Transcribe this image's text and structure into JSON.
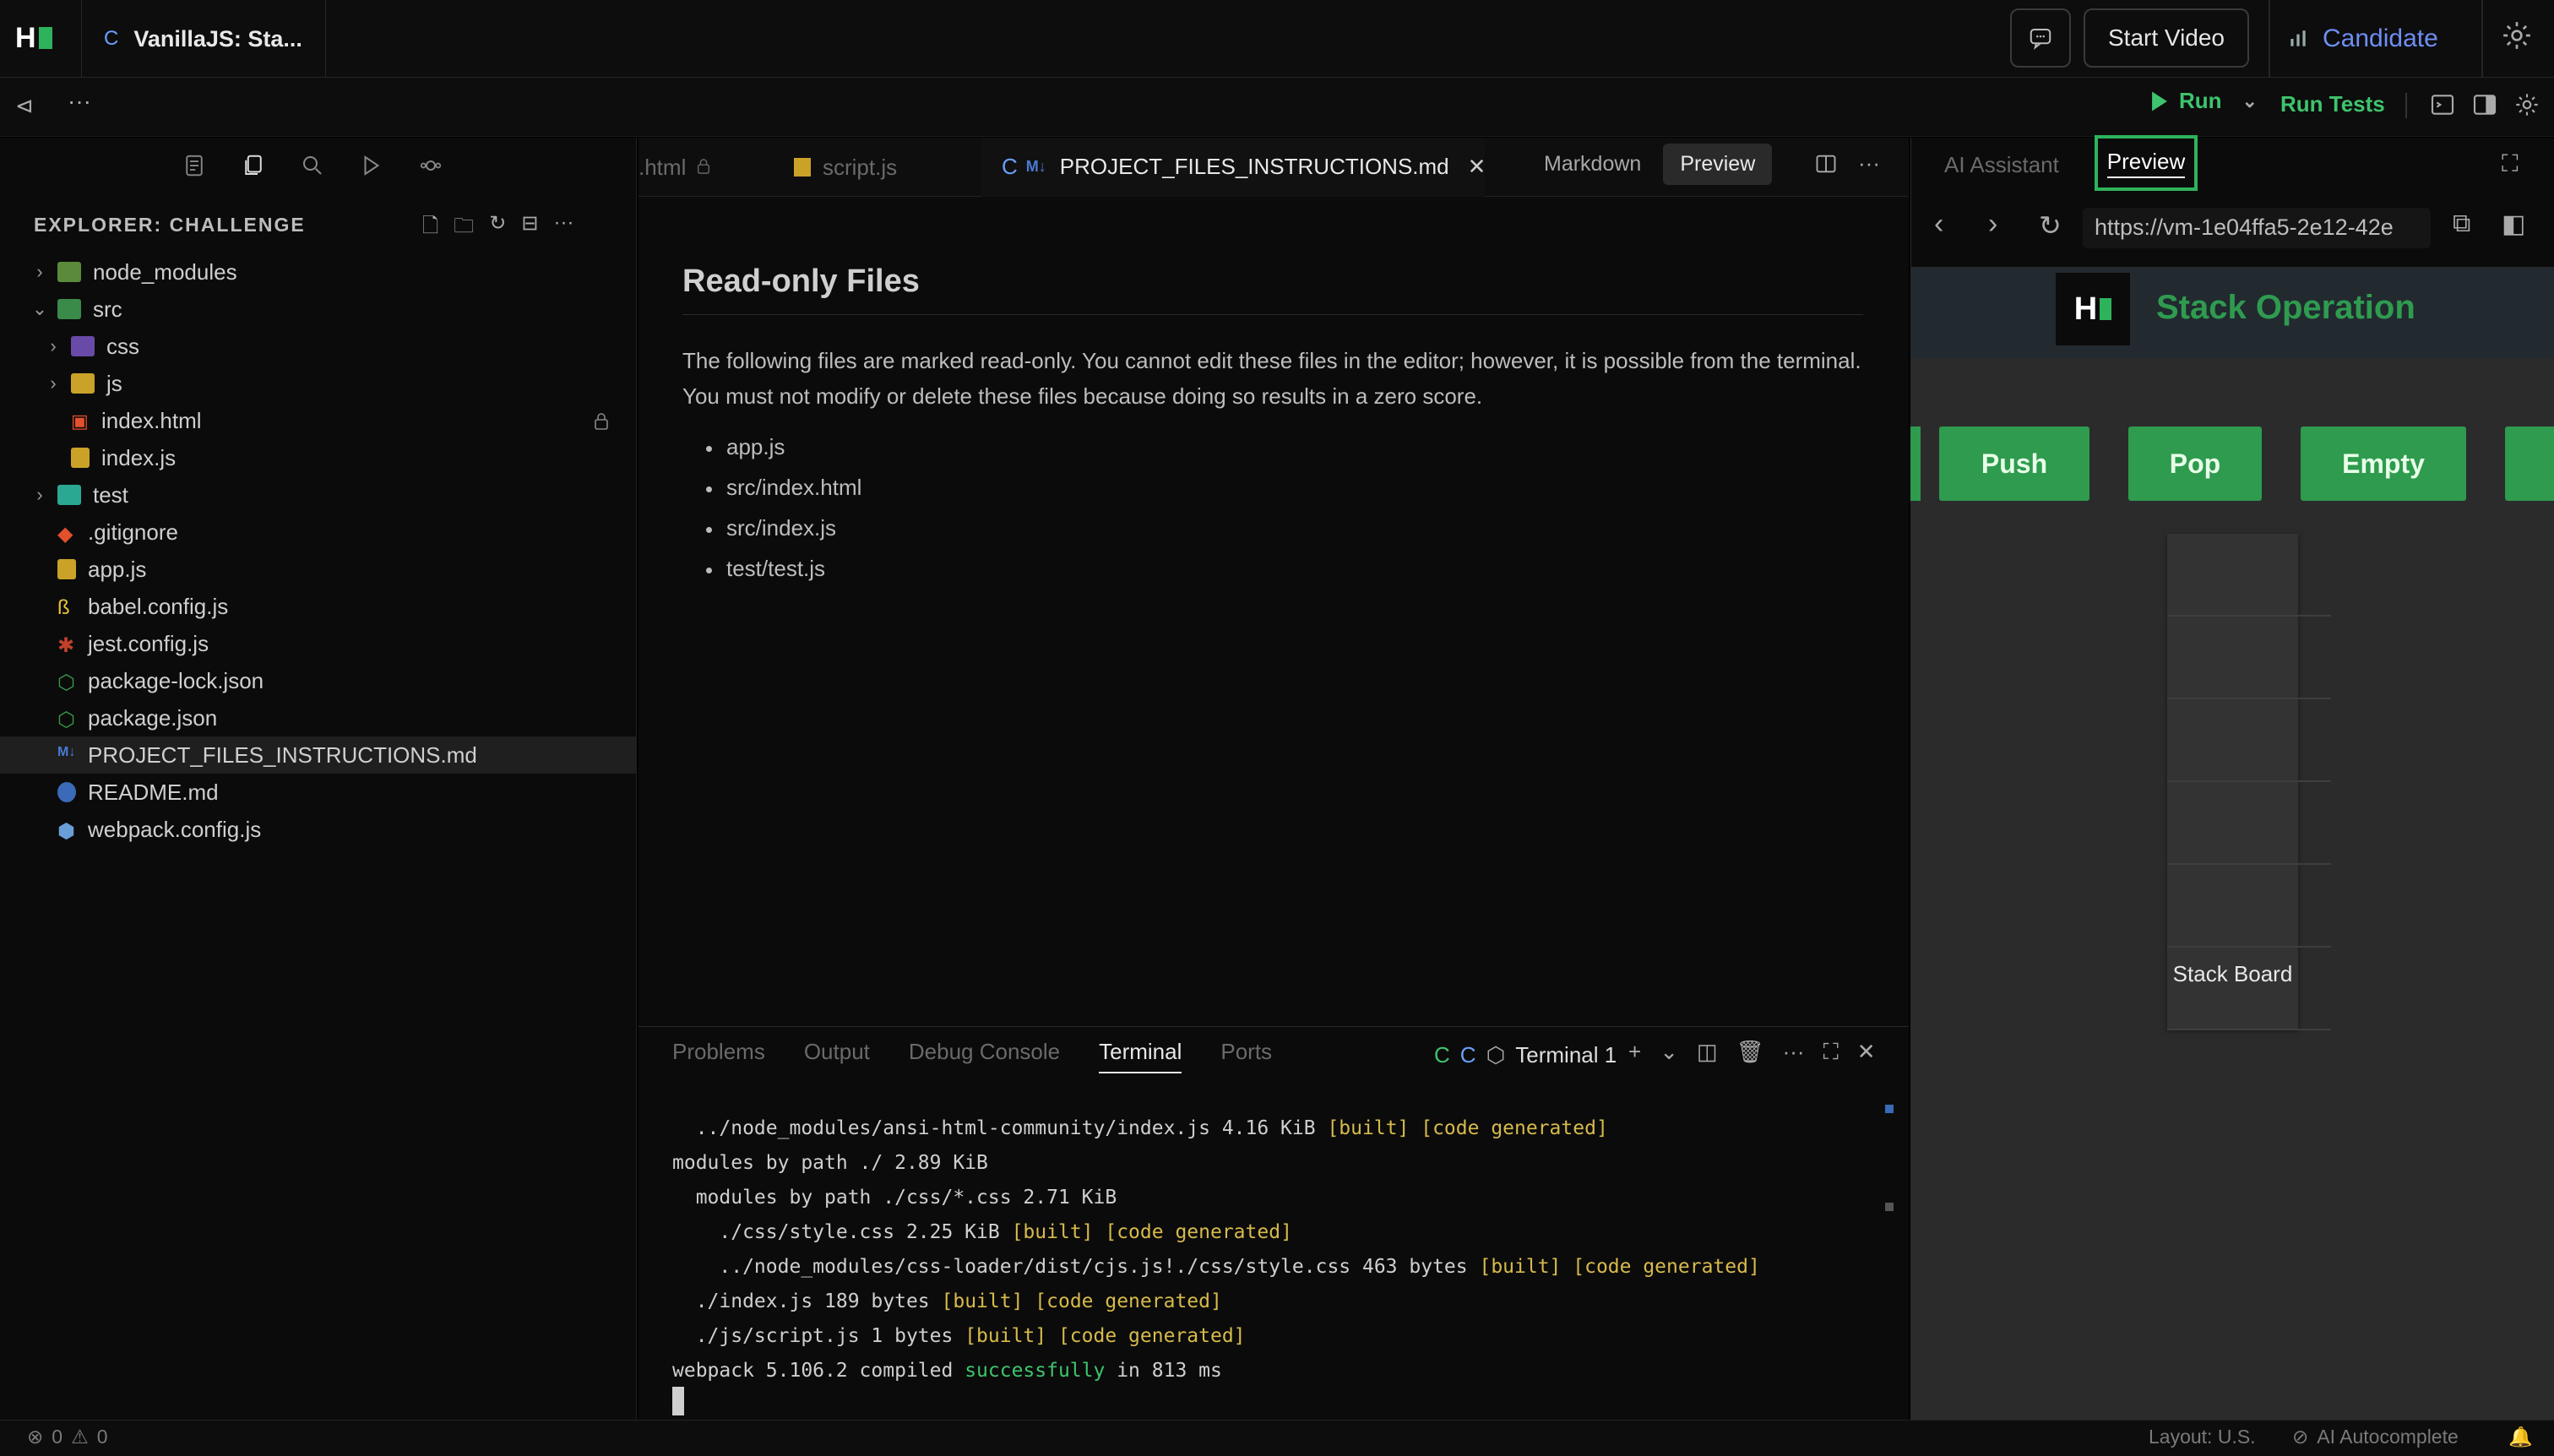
{
  "topbar": {
    "tab_icon": "C",
    "tab_title": "VanillaJS: Sta...",
    "start_video": "Start Video",
    "candidate": "Candidate"
  },
  "toolbar": {
    "run": "Run",
    "run_tests": "Run Tests"
  },
  "explorer": {
    "title": "EXPLORER: CHALLENGE",
    "items": [
      {
        "label": "node_modules"
      },
      {
        "label": "src"
      },
      {
        "label": "css"
      },
      {
        "label": "js"
      },
      {
        "label": "index.html"
      },
      {
        "label": "index.js"
      },
      {
        "label": "test"
      },
      {
        "label": ".gitignore"
      },
      {
        "label": "app.js"
      },
      {
        "label": "babel.config.js"
      },
      {
        "label": "jest.config.js"
      },
      {
        "label": "package-lock.json"
      },
      {
        "label": "package.json"
      },
      {
        "label": "PROJECT_FILES_INSTRUCTIONS.md"
      },
      {
        "label": "README.md"
      },
      {
        "label": "webpack.config.js"
      }
    ]
  },
  "editor": {
    "tabs": [
      {
        "label": ".html"
      },
      {
        "label": "script.js"
      },
      {
        "label": "PROJECT_FILES_INSTRUCTIONS.md"
      }
    ],
    "active_icon": "C",
    "md_badge": "M↓",
    "markdown_btn": "Markdown",
    "preview_btn": "Preview",
    "heading": "Read-only Files",
    "paragraph": "The following files are marked read-only. You cannot edit these files in the editor; however, it is possible from the terminal. You must not modify or delete these files because doing so results in a zero score.",
    "list": [
      "app.js",
      "src/index.html",
      "src/index.js",
      "test/test.js"
    ]
  },
  "panel": {
    "tabs": [
      "Problems",
      "Output",
      "Debug Console",
      "Terminal",
      "Ports"
    ],
    "terminal_name": "Terminal 1",
    "lines": {
      "l1a": "  ../node_modules/ansi-html-community/index.js 4.16 KiB ",
      "l1b": "[built] [code generated]",
      "l2": "modules by path ./ 2.89 KiB",
      "l3": "  modules by path ./css/*.css 2.71 KiB",
      "l4a": "    ./css/style.css 2.25 KiB ",
      "l4b": "[built] [code generated]",
      "l5a": "    ../node_modules/css-loader/dist/cjs.js!./css/style.css 463 bytes ",
      "l5b": "[built] [code generated]",
      "l6a": "  ./index.js 189 bytes ",
      "l6b": "[built] [code generated]",
      "l7a": "  ./js/script.js 1 bytes ",
      "l7b": "[built] [code generated]",
      "l8a": "webpack 5.106.2 compiled ",
      "l8b": "successfully",
      "l8c": " in 813 ms"
    }
  },
  "right": {
    "ai_tab": "AI Assistant",
    "preview_tab": "Preview",
    "url": "https://vm-1e04ffa5-2e12-42e",
    "app": {
      "title": "Stack Operation",
      "buttons": [
        "Push",
        "Pop",
        "Empty"
      ],
      "board_label": "Stack Board"
    }
  },
  "status": {
    "errors": "0",
    "warnings": "0",
    "layout": "Layout: U.S.",
    "autocomplete": "AI Autocomplete"
  }
}
